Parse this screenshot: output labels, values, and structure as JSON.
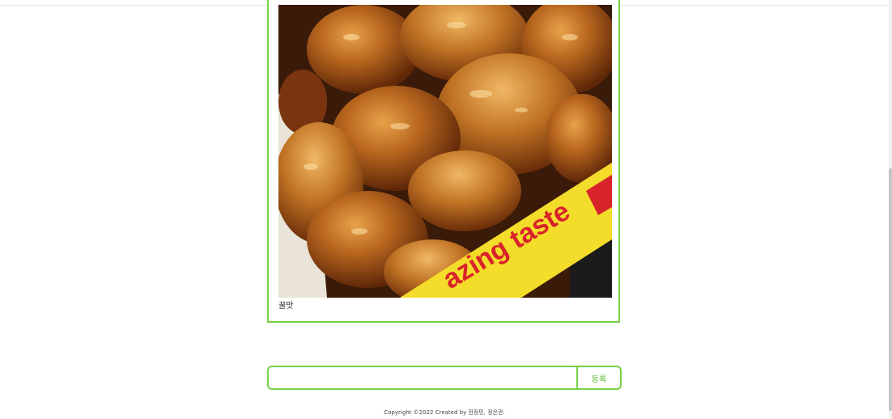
{
  "post": {
    "caption": "꿀맛",
    "photo": {
      "subject": "honey-glazed fried chicken in a paper box",
      "box_text": "azing taste",
      "colors": {
        "box_yellow": "#f4dc2a",
        "box_red": "#d8232a",
        "sauce": "#8a3d0c"
      }
    }
  },
  "comment_form": {
    "input_value": "",
    "input_placeholder": "",
    "submit_label": "등록"
  },
  "footer": {
    "text": "Copyright ©2022 Created by 전정민, 정은관."
  },
  "theme": {
    "accent": "#78d047",
    "accent_text": "#57b82a"
  }
}
